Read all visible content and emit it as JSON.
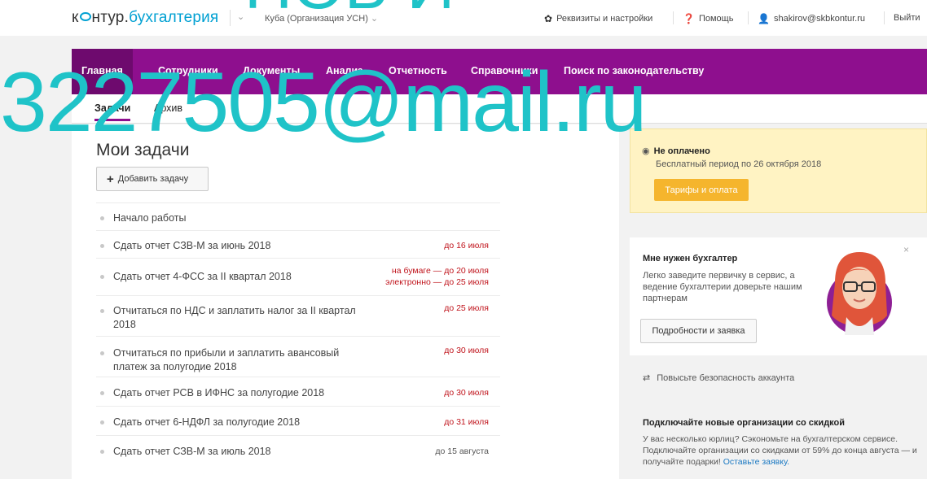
{
  "header": {
    "logo_prefix": "к",
    "logo_mid": "нтур.",
    "logo_brand": "бухгалтерия",
    "org_selector": "Куба (Организация УСН)",
    "org_chevron": "⌄",
    "settings": "Реквизиты и настройки",
    "help": "Помощь",
    "user": "shakirov@skbkontur.ru",
    "logout": "Выйти"
  },
  "nav": {
    "items": [
      "Главная",
      "Сотрудники",
      "Документы",
      "Анализ",
      "Отчетность",
      "Справочники",
      "Поиск по законодательству"
    ]
  },
  "subtabs": [
    "Задачи",
    "Архив"
  ],
  "main": {
    "title": "Мои задачи",
    "add_task": "Добавить задачу",
    "tasks": [
      {
        "text": "Начало работы",
        "due": [],
        "due_color": "grey"
      },
      {
        "text": "Сдать отчет СЗВ-М за июнь 2018",
        "due": [
          "до 16 июля"
        ],
        "due_color": "red"
      },
      {
        "text": "Сдать отчет 4-ФСС за II квартал 2018",
        "due": [
          "на бумаге — до 20 июля",
          "электронно — до 25 июля"
        ],
        "due_color": "red"
      },
      {
        "text": "Отчитаться по НДС и заплатить налог за II квартал 2018",
        "due": [
          "до 25 июля"
        ],
        "due_color": "red"
      },
      {
        "text": "Отчитаться по прибыли и заплатить авансовый платеж за полугодие 2018",
        "due": [
          "до 30 июля"
        ],
        "due_color": "red"
      },
      {
        "text": "Сдать отчет РСВ в ИФНС за полугодие 2018",
        "due": [
          "до 30 июля"
        ],
        "due_color": "red"
      },
      {
        "text": "Сдать отчет 6-НДФЛ за полугодие 2018",
        "due": [
          "до 31 июля"
        ],
        "due_color": "red"
      },
      {
        "text": "Сдать отчет СЗВ-М за июль 2018",
        "due": [
          "до 15 августа"
        ],
        "due_color": "grey"
      }
    ]
  },
  "sidebar": {
    "unpaid_title": "Не оплачено",
    "unpaid_sub": "Бесплатный период по 26 октября 2018",
    "tariffs_button": "Тарифы и оплата",
    "accountant_title": "Мне нужен бухгалтер",
    "accountant_text": "Легко заведите первичку в сервис, а ведение бухгалтерии доверьте нашим партнерам",
    "accountant_button": "Подробности и заявка",
    "security": "Повысьте безопасность аккаунта",
    "promo_title": "Подключайте новые организации со скидкой",
    "promo_text": "У вас несколько юрлиц? Сэкономьте на бухгалтерском сервисе. Подключайте организации со скидками от 59% до конца августа — и получайте подарки!",
    "promo_link": "Оставьте заявку."
  },
  "watermark": {
    "text": "3227505@mail.ru",
    "top_fragment": "ПОБ И"
  },
  "colors": {
    "brand": "#8e0f8e",
    "accent": "#00a0d2",
    "watermark": "#1fc3c8",
    "due_red": "#c0141c",
    "button_orange": "#f5b52d"
  }
}
